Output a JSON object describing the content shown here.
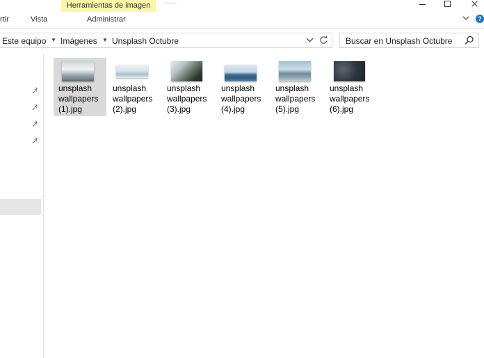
{
  "ribbon": {
    "context_tab": "Herramientas de imagen",
    "tabs": [
      "rtir",
      "Vista",
      "Administrar"
    ]
  },
  "address": {
    "crumbs": [
      "Este equipo",
      "Imágenes",
      "Unsplash Octubre"
    ]
  },
  "search": {
    "placeholder": "Buscar en Unsplash Octubre"
  },
  "files": [
    {
      "line1": "unsplash",
      "line2": "wallpapers",
      "line3": "(1).jpg",
      "selected": true
    },
    {
      "line1": "unsplash",
      "line2": "wallpapers",
      "line3": "(2).jpg",
      "selected": false
    },
    {
      "line1": "unsplash",
      "line2": "wallpapers",
      "line3": "(3).jpg",
      "selected": false
    },
    {
      "line1": "unsplash",
      "line2": "wallpapers",
      "line3": "(4).jpg",
      "selected": false
    },
    {
      "line1": "unsplash",
      "line2": "wallpapers",
      "line3": "(5).jpg",
      "selected": false
    },
    {
      "line1": "unsplash",
      "line2": "wallpapers",
      "line3": "(6).jpg",
      "selected": false
    }
  ],
  "colors": {
    "context_tab_bg": "#fbf7a8",
    "selection_bg": "#d9d9d9",
    "help_icon": "#1a73c8"
  },
  "icons": {
    "pins": [
      "pin-icon",
      "pin-icon",
      "pin-icon",
      "pin-icon"
    ],
    "address_dropdown": "chevron-down-icon",
    "refresh": "refresh-icon",
    "search": "search-icon",
    "ribbon_collapse": "chevron-down-icon",
    "help": "help-icon"
  }
}
